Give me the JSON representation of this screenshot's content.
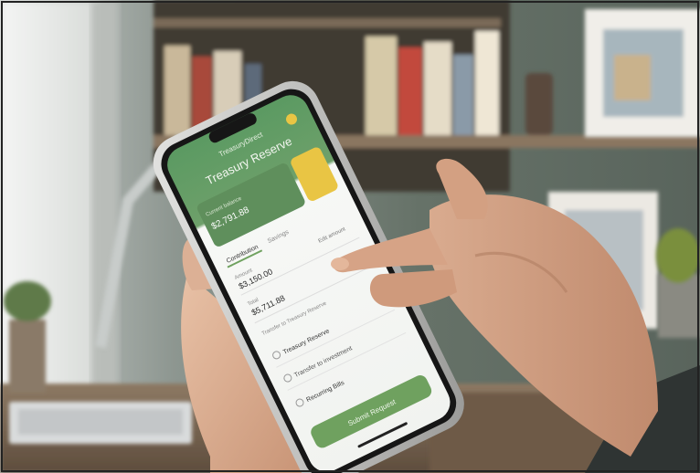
{
  "app": {
    "header_title": "TreasuryDirect",
    "page_title": "Treasury Reserve",
    "balance_caption": "Current balance",
    "balance_amount": "$2,791.88",
    "tabs": [
      "Contribution",
      "Savings"
    ],
    "fields": [
      {
        "label": "Amount",
        "value": "$3,150.00",
        "note": "Edit amount"
      },
      {
        "label": "Total",
        "value": "$5,711.88",
        "note": ""
      }
    ],
    "section_label": "Transfer to Treasury Reserve",
    "options": [
      "Treasury Reserve",
      "Transfer to investment",
      "Recurring Bills"
    ],
    "cta_label": "Submit Request"
  },
  "colors": {
    "accent_green": "#6fa15f",
    "header_green": "#4f8d56",
    "card_yellow": "#e9c544",
    "wall": "#6f7a70",
    "shelf_wood": "#7d6a55"
  }
}
